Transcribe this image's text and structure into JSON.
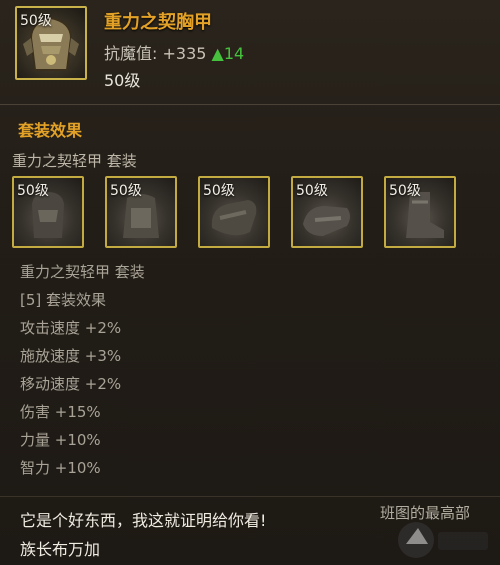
{
  "item": {
    "level_badge": "50级",
    "name": "重力之契胸甲",
    "stat_label": "抗魔值:",
    "stat_value": "+335",
    "stat_increase": "▲14",
    "level": "50级"
  },
  "set_section": {
    "title": "套装效果",
    "set_name_header": "重力之契轻甲 套装",
    "pieces": [
      {
        "level": "50级",
        "icon": "armor-piece-icon"
      },
      {
        "level": "50级",
        "icon": "armor-piece-icon"
      },
      {
        "level": "50级",
        "icon": "gauntlet-icon"
      },
      {
        "level": "50级",
        "icon": "gauntlet-icon"
      },
      {
        "level": "50级",
        "icon": "boots-icon"
      }
    ],
    "set_name_repeat": "重力之契轻甲 套装",
    "bonus_header": "[5] 套装效果",
    "bonuses": [
      "攻击速度 +2%",
      "施放速度 +3%",
      "移动速度 +2%",
      "伤害 +15%",
      "力量 +10%",
      "智力 +10%"
    ]
  },
  "flavor": {
    "quote": "它是个好东西，我这就证明给你看!",
    "signer": "族长布万加",
    "obscured_text": "班图的最高部"
  },
  "colors": {
    "title_gold": "#e3a227",
    "stat_green": "#45c13d",
    "frame_gold": "#c9b24a",
    "set_text_gray": "#a9a397"
  }
}
